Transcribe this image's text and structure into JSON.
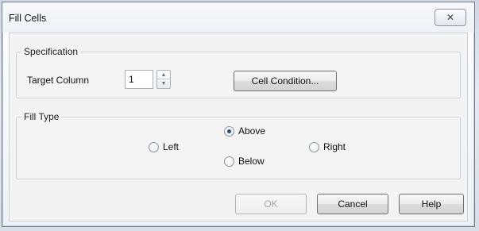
{
  "window": {
    "title": "Fill Cells",
    "close_glyph": "✕",
    "close_icon": "close-icon"
  },
  "specification": {
    "legend": "Specification",
    "target_column_label": "Target Column",
    "target_column_value": "1",
    "spin_up_icon": "chevron-up-icon",
    "spin_down_icon": "chevron-down-icon",
    "spin_up_glyph": "▲",
    "spin_down_glyph": "▼",
    "cell_condition_label": "Cell Condition..."
  },
  "fill_type": {
    "legend": "Fill Type",
    "options": [
      {
        "label": "Left",
        "checked": false
      },
      {
        "label": "Above",
        "checked": true
      },
      {
        "label": "Below",
        "checked": false
      },
      {
        "label": "Right",
        "checked": false
      }
    ]
  },
  "buttons": {
    "ok_label": "OK",
    "ok_enabled": false,
    "cancel_label": "Cancel",
    "help_label": "Help"
  }
}
